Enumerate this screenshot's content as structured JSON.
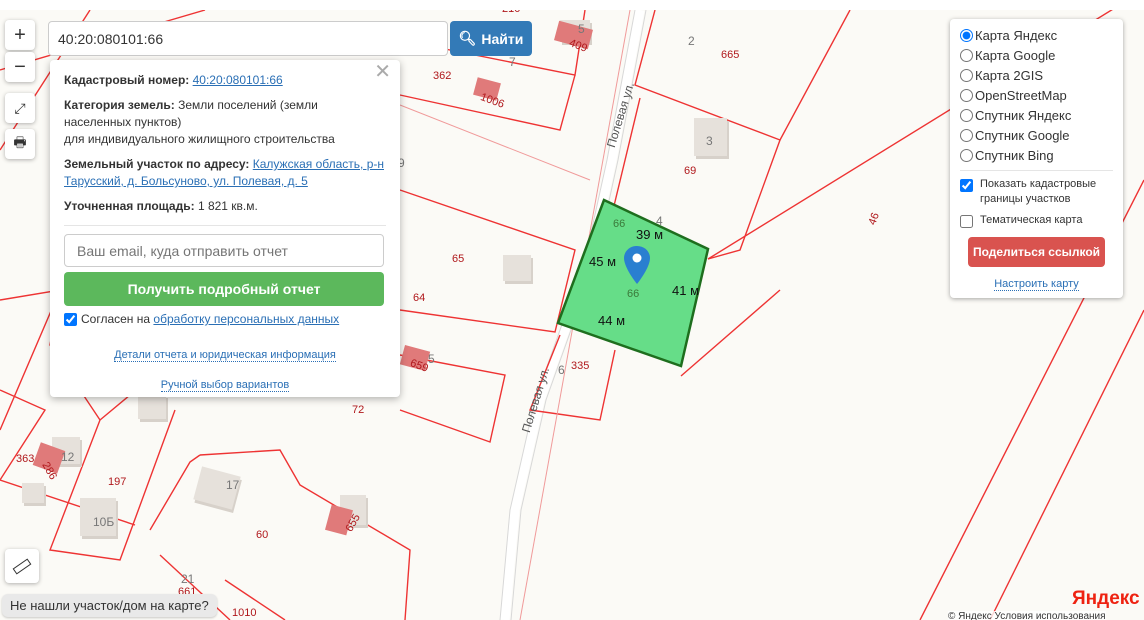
{
  "search": {
    "value": "40:20:080101:66",
    "button": "Найти",
    "icon": "search-icon"
  },
  "zoom": {
    "in": "+",
    "out": "−"
  },
  "popup": {
    "cadastral_label": "Кадастровый номер:",
    "cadastral_value": "40:20:080101:66",
    "category_label": "Категория земель:",
    "category_value": "Земли поселений (земли населенных пунктов)",
    "usage": "для индивидуального жилищного строительства",
    "address_label": "Земельный участок по адресу:",
    "address_value": "Калужская область, р-н Тарусский, д. Больсуново, ул. Полевая, д. 5",
    "area_label": "Уточненная площадь:",
    "area_value": "1 821 кв.м.",
    "email_placeholder": "Ваш email, куда отправить отчет",
    "report_button": "Получить подробный отчет",
    "consent_text": "Согласен на",
    "consent_link": "обработку персональных данных",
    "consent_checked": true,
    "details_link": "Детали отчета и юридическая информация",
    "manual_link": "Ручной выбор вариантов",
    "close": "✕"
  },
  "layers": {
    "options": [
      "Карта Яндекс",
      "Карта Google",
      "Карта 2GIS",
      "OpenStreetMap",
      "Спутник Яндекс",
      "Спутник Google",
      "Спутник Bing"
    ],
    "selected": "Карта Яндекс",
    "show_borders": "Показать кадастровые границы участков",
    "show_borders_checked": true,
    "thematic": "Тематическая карта",
    "thematic_checked": false,
    "share_button": "Поделиться ссылкой",
    "configure_link": "Настроить карту"
  },
  "not_found_button": "Не нашли участок/дом на карте?",
  "map": {
    "parcel_color": "#66dd88",
    "edges": [
      "39 м",
      "45 м",
      "41 м",
      "44 м"
    ],
    "street": "Полевая ул.",
    "street2": "Полевая ул.",
    "labels": [
      "210",
      "7",
      "362",
      "1006",
      "409",
      "2",
      "665",
      "69",
      "46",
      "65",
      "64",
      "659",
      "72",
      "363",
      "286",
      "197",
      "60",
      "655",
      "1010",
      "661",
      "335",
      "66",
      "66",
      "4",
      "6",
      "9"
    ],
    "houses": [
      "5",
      "3",
      "12",
      "17",
      "10Б",
      "21",
      "5"
    ],
    "brand": "Яндекс",
    "attribution": "© Яндекс  Условия использования"
  }
}
